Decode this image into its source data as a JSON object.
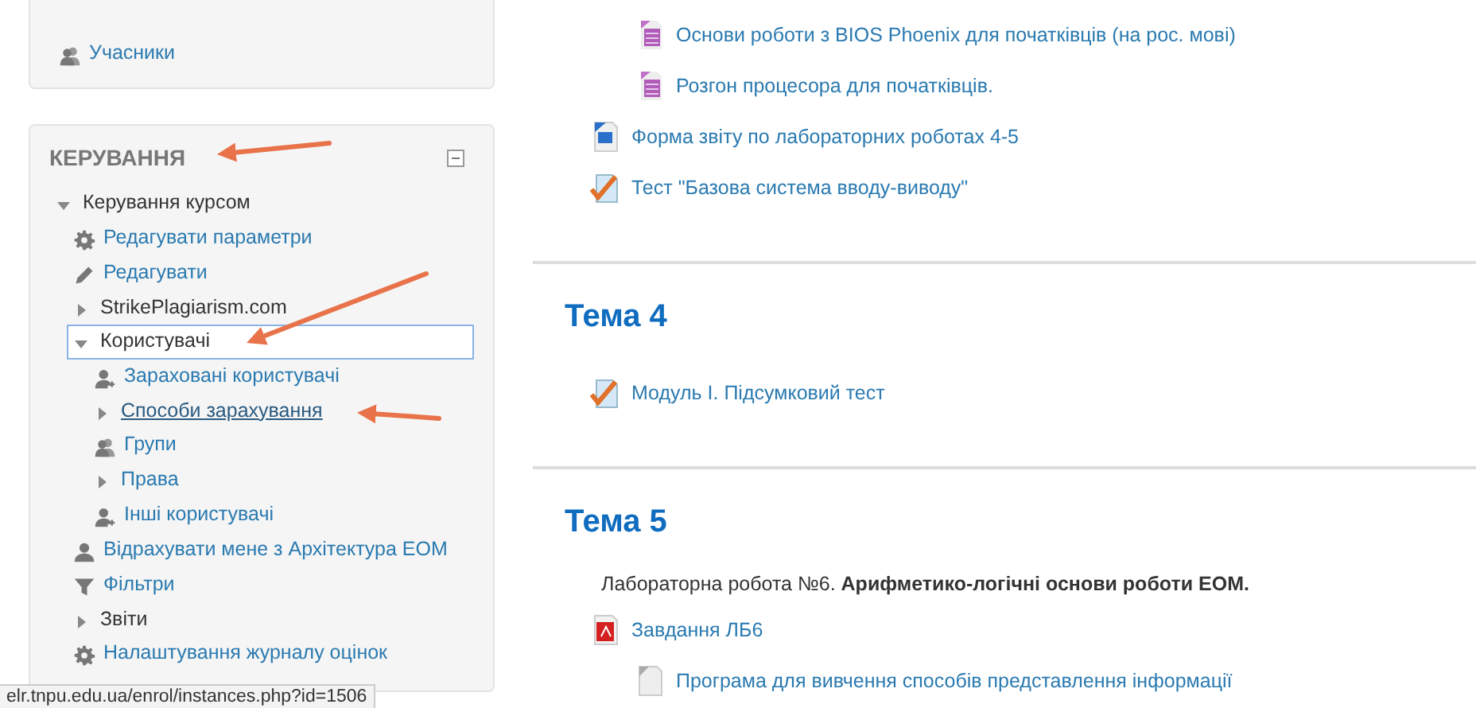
{
  "participants_block": {
    "items": [
      {
        "label": "Учасники",
        "kind": "users"
      }
    ]
  },
  "admin_block": {
    "title": "КЕРУВАННЯ",
    "tree": [
      {
        "label": "Керування курсом",
        "kind": "branch",
        "link": false,
        "expanded": true,
        "selected": false,
        "hovered": false,
        "children": [
          {
            "label": "Редагувати параметри",
            "kind": "gear",
            "link": true,
            "selected": false,
            "hovered": false
          },
          {
            "label": "Редагувати",
            "kind": "pencil",
            "link": true,
            "selected": false,
            "hovered": false
          },
          {
            "label": "StrikePlagiarism.com",
            "kind": "branch",
            "link": false,
            "expanded": false,
            "selected": false,
            "hovered": false
          },
          {
            "label": "Користувачі",
            "kind": "branch",
            "link": false,
            "expanded": true,
            "selected": true,
            "hovered": false,
            "children": [
              {
                "label": "Зараховані користувачі",
                "kind": "user-plus",
                "link": true,
                "selected": false,
                "hovered": false
              },
              {
                "label": "Способи зарахування",
                "kind": "branch",
                "link": true,
                "expanded": false,
                "selected": false,
                "hovered": true
              },
              {
                "label": "Групи",
                "kind": "users",
                "link": true,
                "selected": false,
                "hovered": false
              },
              {
                "label": "Права",
                "kind": "branch",
                "link": true,
                "expanded": false,
                "selected": false,
                "hovered": false
              },
              {
                "label": "Інші користувачі",
                "kind": "user-plus",
                "link": true,
                "selected": false,
                "hovered": false
              }
            ]
          },
          {
            "label": "Відрахувати мене з Архітектура ЕОМ",
            "kind": "user",
            "link": true,
            "selected": false,
            "hovered": false
          },
          {
            "label": "Фільтри",
            "kind": "filter",
            "link": true,
            "selected": false,
            "hovered": false
          },
          {
            "label": "Звіти",
            "kind": "branch",
            "link": false,
            "expanded": false,
            "selected": false,
            "hovered": false
          },
          {
            "label": "Налаштування журналу оцінок",
            "kind": "gear",
            "link": true,
            "selected": false,
            "hovered": false
          }
        ]
      }
    ]
  },
  "sections": [
    {
      "activities": [
        {
          "label": "Основи роботи з BIOS Phoenix для початківців (на рос. мові)",
          "kind": "book",
          "indented": true
        },
        {
          "label": "Розгон процесора для початківців.",
          "kind": "book",
          "indented": true
        },
        {
          "label": "Форма звіту по лабораторних роботах 4-5",
          "kind": "word",
          "indented": false
        },
        {
          "label": "Тест \"Базова система вводу-виводу\"",
          "kind": "quiz",
          "indented": false
        }
      ]
    },
    {
      "title": "Тема 4",
      "activities": [
        {
          "label": "Модуль І. Підсумковий тест",
          "kind": "quiz",
          "indented": false
        }
      ]
    },
    {
      "title": "Тема 5",
      "summary": "Лабораторна робота №6. **Арифметико-логічні основи роботи ЕОМ.**",
      "activities": [
        {
          "label": "Завдання ЛБ6",
          "kind": "pdf",
          "indented": false
        },
        {
          "label": "Програма для вивчення способів представлення інформації",
          "kind": "file",
          "indented": true
        }
      ]
    }
  ],
  "status_bar": {
    "url": "elr.tnpu.edu.ua/enrol/instances.php?id=1506"
  }
}
